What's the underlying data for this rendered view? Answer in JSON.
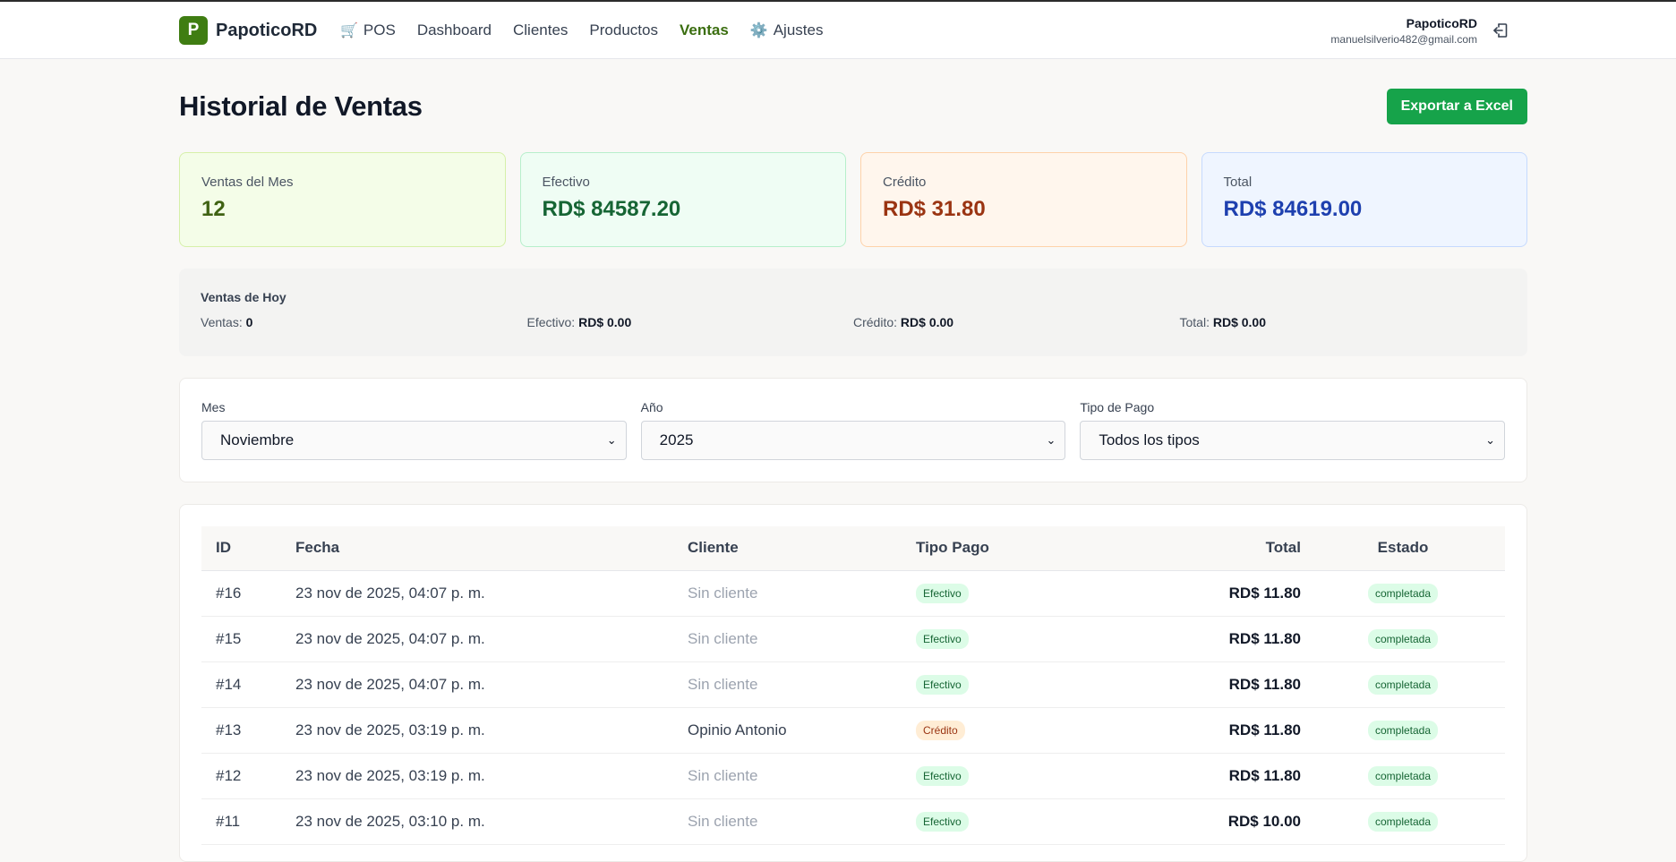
{
  "brand": {
    "logo_letter": "P",
    "name": "PapoticoRD"
  },
  "nav": [
    {
      "label": "POS",
      "icon": "cart-icon",
      "emoji": "🛒",
      "active": false
    },
    {
      "label": "Dashboard",
      "active": false
    },
    {
      "label": "Clientes",
      "active": false
    },
    {
      "label": "Productos",
      "active": false
    },
    {
      "label": "Ventas",
      "active": true
    },
    {
      "label": "Ajustes",
      "icon": "gear-icon",
      "emoji": "⚙️",
      "active": false
    }
  ],
  "user": {
    "name": "PapoticoRD",
    "email": "manuelsilverio482@gmail.com"
  },
  "page": {
    "title": "Historial de Ventas",
    "export_label": "Exportar a Excel"
  },
  "stats": [
    {
      "label": "Ventas del Mes",
      "value": "12"
    },
    {
      "label": "Efectivo",
      "value": "RD$ 84587.20"
    },
    {
      "label": "Crédito",
      "value": "RD$ 31.80"
    },
    {
      "label": "Total",
      "value": "RD$ 84619.00"
    }
  ],
  "today": {
    "title": "Ventas de Hoy",
    "items": [
      {
        "label": "Ventas:",
        "value": "0"
      },
      {
        "label": "Efectivo:",
        "value": "RD$ 0.00"
      },
      {
        "label": "Crédito:",
        "value": "RD$ 0.00"
      },
      {
        "label": "Total:",
        "value": "RD$ 0.00"
      }
    ]
  },
  "filters": [
    {
      "label": "Mes",
      "value": "Noviembre"
    },
    {
      "label": "Año",
      "value": "2025"
    },
    {
      "label": "Tipo de Pago",
      "value": "Todos los tipos"
    }
  ],
  "table": {
    "headers": [
      "ID",
      "Fecha",
      "Cliente",
      "Tipo Pago",
      "Total",
      "Estado"
    ],
    "rows": [
      {
        "id": "#16",
        "date": "23 nov de 2025, 04:07 p. m.",
        "client": "Sin cliente",
        "payment": "Efectivo",
        "total": "RD$ 11.80",
        "status": "completada"
      },
      {
        "id": "#15",
        "date": "23 nov de 2025, 04:07 p. m.",
        "client": "Sin cliente",
        "payment": "Efectivo",
        "total": "RD$ 11.80",
        "status": "completada"
      },
      {
        "id": "#14",
        "date": "23 nov de 2025, 04:07 p. m.",
        "client": "Sin cliente",
        "payment": "Efectivo",
        "total": "RD$ 11.80",
        "status": "completada"
      },
      {
        "id": "#13",
        "date": "23 nov de 2025, 03:19 p. m.",
        "client": "Opinio Antonio",
        "payment": "Crédito",
        "total": "RD$ 11.80",
        "status": "completada"
      },
      {
        "id": "#12",
        "date": "23 nov de 2025, 03:19 p. m.",
        "client": "Sin cliente",
        "payment": "Efectivo",
        "total": "RD$ 11.80",
        "status": "completada"
      },
      {
        "id": "#11",
        "date": "23 nov de 2025, 03:10 p. m.",
        "client": "Sin cliente",
        "payment": "Efectivo",
        "total": "RD$ 10.00",
        "status": "completada"
      }
    ]
  },
  "colors": {
    "brand": "#3f7d12",
    "export": "#16a34a",
    "active_nav": "#3b6e10"
  }
}
